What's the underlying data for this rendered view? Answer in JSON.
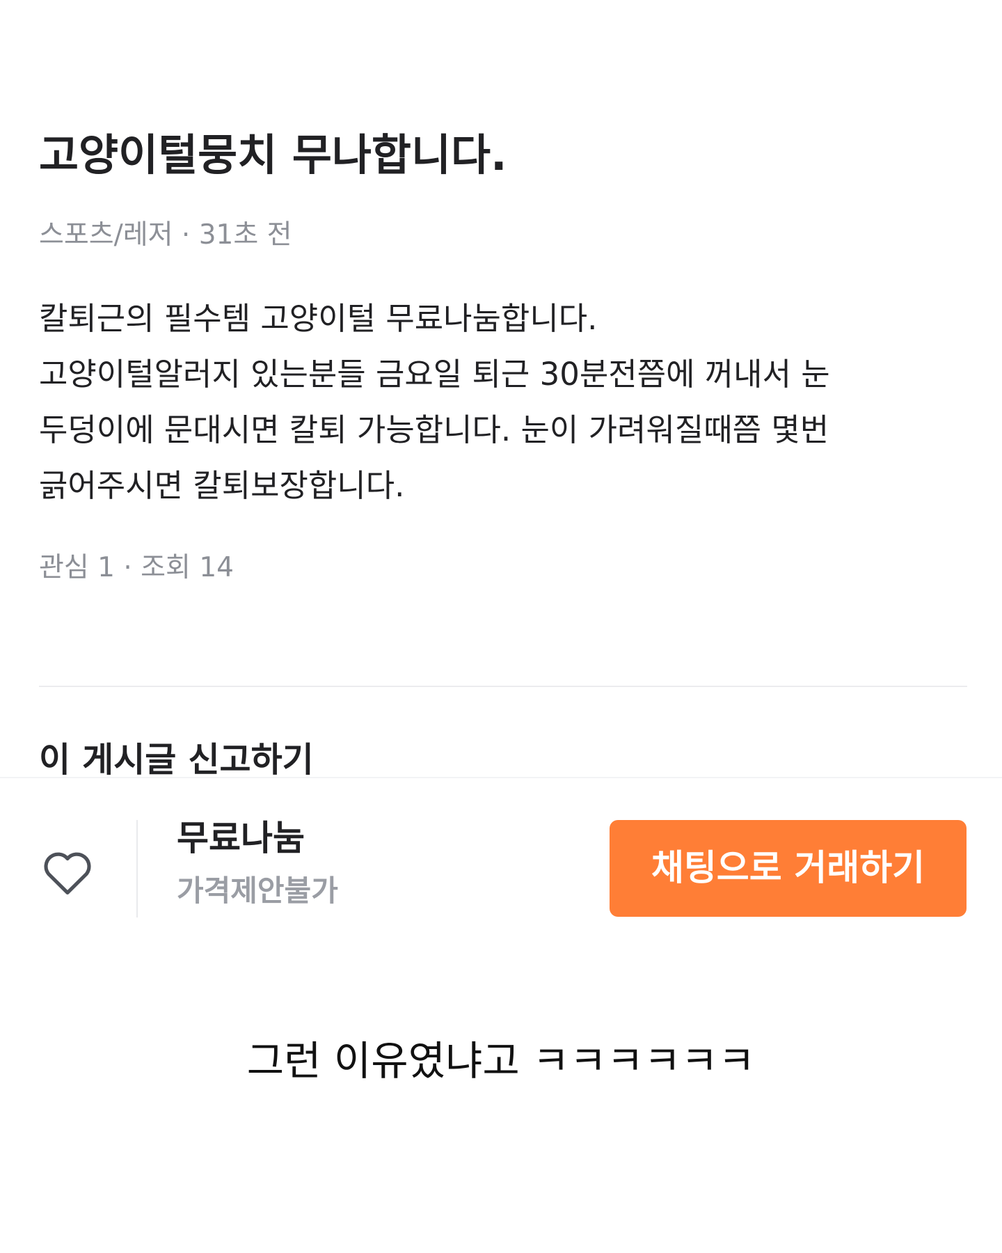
{
  "post": {
    "title": "고양이털뭉치 무나합니다.",
    "meta": "스포츠/레저 · 31초 전",
    "body_lines": [
      "칼퇴근의 필수템 고양이털 무료나눔합니다.",
      "고양이털알러지 있는분들 금요일 퇴근 30분전쯤에 꺼내서 눈",
      "두덩이에 문대시면 칼퇴 가능합니다. 눈이 가려워질때쯤 몇번",
      "긁어주시면 칼퇴보장합니다."
    ],
    "stats": "관심 1 · 조회 14",
    "report_label": "이 게시글 신고하기"
  },
  "bottom_bar": {
    "like_icon": "heart-outline-icon",
    "price_label": "무료나눔",
    "price_note": "가격제안불가",
    "chat_button_label": "채팅으로 거래하기"
  },
  "caption": "그런 이유였냐고 ㅋㅋㅋㅋㅋㅋ",
  "colors": {
    "accent": "#ff7e36",
    "text_primary": "#212124",
    "text_secondary": "#8c8f96",
    "divider": "#ececee",
    "icon": "#4d5159"
  }
}
